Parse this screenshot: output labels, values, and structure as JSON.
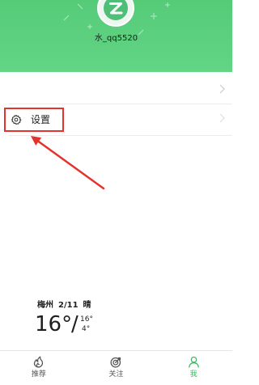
{
  "colors": {
    "brand_green_top": "#55cb78",
    "brand_green_bottom": "#63d586",
    "annotation_red": "#e5322d",
    "active_tab": "#3cbb62"
  },
  "profile": {
    "avatar_icon": "z-logo-avatar-icon",
    "username": "水_qq5520"
  },
  "menu": {
    "items": [
      {
        "chevron": "chevron-right-icon"
      },
      {
        "label": "设置",
        "icon": "gear-icon",
        "chevron": "chevron-right-icon"
      }
    ]
  },
  "weather": {
    "city": "梅州",
    "date": "2/11",
    "condition": "晴",
    "current_temp": "16°",
    "separator": "/",
    "high_temp": "16°",
    "low_temp": "4°"
  },
  "bottom_nav": {
    "tabs": [
      {
        "label": "推荐",
        "icon": "recommend-icon",
        "active": false
      },
      {
        "label": "关注",
        "icon": "follow-icon",
        "active": false
      },
      {
        "label": "我",
        "icon": "profile-icon",
        "active": true
      }
    ]
  }
}
